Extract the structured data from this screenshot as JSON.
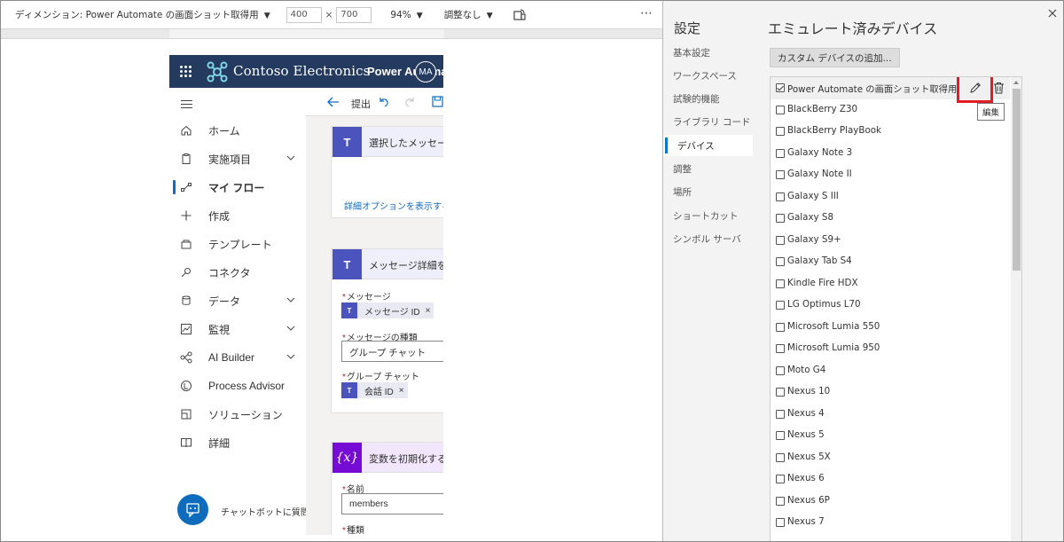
{
  "toolbar": {
    "dimension_label": "ディメンション: Power Automate の画面ショット取得用",
    "width": "400",
    "height": "700",
    "times": "×",
    "zoom": "94%",
    "throttling": "調整なし"
  },
  "device": {
    "brand": "Contoso Electronics",
    "app_name": "Power Automate",
    "avatar_initials": "MA",
    "nav": [
      {
        "label": "ホーム"
      },
      {
        "label": "実施項目"
      },
      {
        "label": "マイ フロー"
      },
      {
        "label": "作成"
      },
      {
        "label": "テンプレート"
      },
      {
        "label": "コネクタ"
      },
      {
        "label": "データ"
      },
      {
        "label": "監視"
      },
      {
        "label": "AI Builder"
      },
      {
        "label": "Process Advisor"
      },
      {
        "label": "ソリューション"
      },
      {
        "label": "詳細"
      }
    ],
    "chatbot_label": "チャットボットに質問",
    "flow_toolbar": {
      "submit": "提出"
    },
    "cards": {
      "selected_message": {
        "title": "選択したメッセージ",
        "link": "詳細オプションを表示する"
      },
      "message_details": {
        "title": "メッセージ詳細を取得",
        "message_label": "メッセージ",
        "message_token": "メッセージ ID",
        "type_label": "メッセージの種類",
        "type_value": "グループ チャット",
        "group_label": "グループ チャット",
        "group_token": "会話 ID"
      },
      "init_variable": {
        "title": "変数を初期化する",
        "name_label": "名前",
        "name_value": "members",
        "type_label": "種類"
      }
    }
  },
  "settings": {
    "title": "設定",
    "items": [
      {
        "label": "基本設定"
      },
      {
        "label": "ワークスペース"
      },
      {
        "label": "試験的機能"
      },
      {
        "label": "ライブラリ コード"
      },
      {
        "label": "デバイス"
      },
      {
        "label": "調整"
      },
      {
        "label": "場所"
      },
      {
        "label": "ショートカット"
      },
      {
        "label": "シンボル サーバ"
      }
    ],
    "active_item": "デバイス"
  },
  "devices_panel": {
    "title": "エミュレート済みデバイス",
    "add_button": "カスタム デバイスの追加...",
    "edit_tooltip": "編集",
    "devices": [
      {
        "name": "Power Automate の画面ショット取得用",
        "checked": true
      },
      {
        "name": "BlackBerry Z30",
        "checked": false
      },
      {
        "name": "BlackBerry PlayBook",
        "checked": false
      },
      {
        "name": "Galaxy Note 3",
        "checked": false
      },
      {
        "name": "Galaxy Note II",
        "checked": false
      },
      {
        "name": "Galaxy S III",
        "checked": false
      },
      {
        "name": "Galaxy S8",
        "checked": false
      },
      {
        "name": "Galaxy S9+",
        "checked": false
      },
      {
        "name": "Galaxy Tab S4",
        "checked": false
      },
      {
        "name": "Kindle Fire HDX",
        "checked": false
      },
      {
        "name": "LG Optimus L70",
        "checked": false
      },
      {
        "name": "Microsoft Lumia 550",
        "checked": false
      },
      {
        "name": "Microsoft Lumia 950",
        "checked": false
      },
      {
        "name": "Moto G4",
        "checked": false
      },
      {
        "name": "Nexus 10",
        "checked": false
      },
      {
        "name": "Nexus 4",
        "checked": false
      },
      {
        "name": "Nexus 5",
        "checked": false
      },
      {
        "name": "Nexus 5X",
        "checked": false
      },
      {
        "name": "Nexus 6",
        "checked": false
      },
      {
        "name": "Nexus 6P",
        "checked": false
      },
      {
        "name": "Nexus 7",
        "checked": false
      }
    ]
  },
  "colors": {
    "header": "#243a5e",
    "accent": "#0f6cbd",
    "highlight": "#e31c23",
    "teams": "#4b53bc",
    "variable": "#770bd6"
  }
}
